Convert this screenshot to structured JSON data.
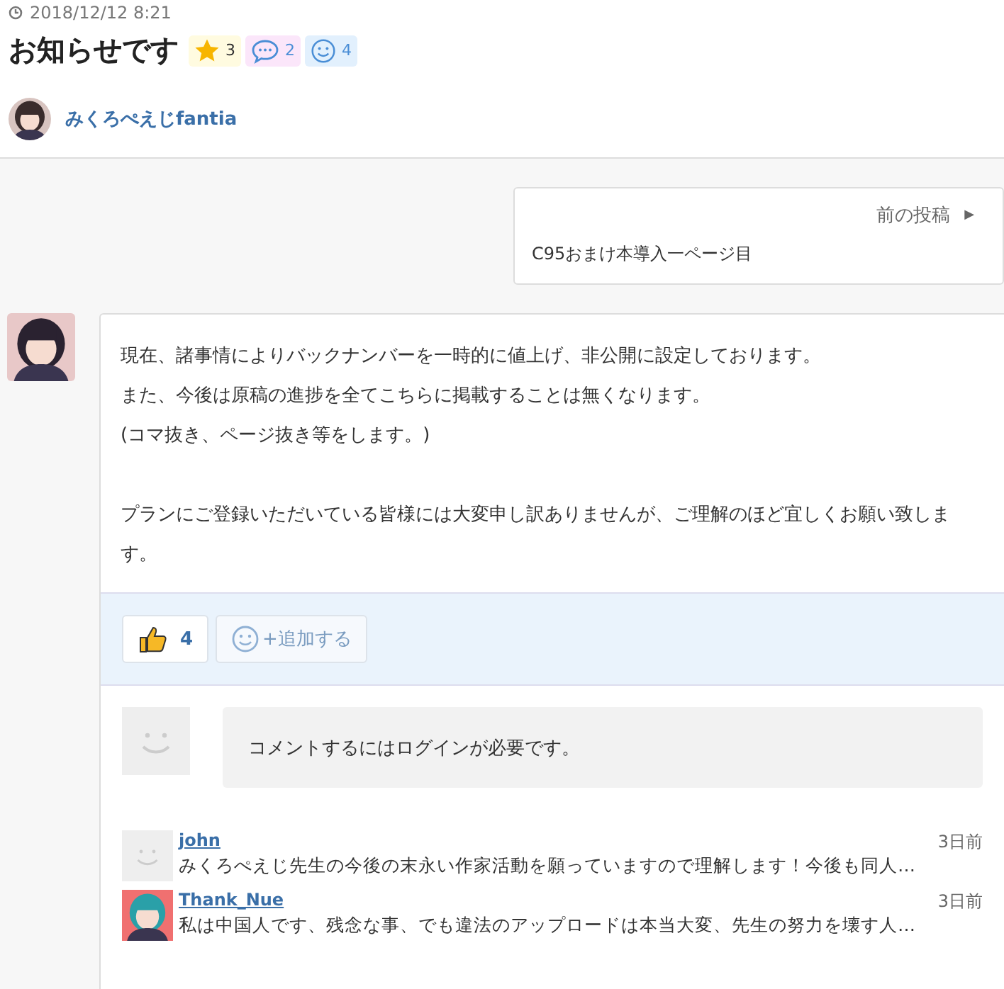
{
  "post": {
    "date": "2018/12/12 8:21",
    "title": "お知らせです",
    "badges": [
      {
        "kind": "star",
        "count": "3"
      },
      {
        "kind": "comment",
        "count": "2"
      },
      {
        "kind": "smile",
        "count": "4"
      }
    ],
    "author": "みくろぺえじfantia"
  },
  "prev_post": {
    "label": "前の投稿",
    "arrow": "▶",
    "title": "C95おまけ本導入一ページ目"
  },
  "body": [
    [
      "現在、諸事情によりバックナンバーを一時的に値上げ、非公開に設定しております。",
      "また、今後は原稿の進捗を全てこちらに掲載することは無くなります。",
      "(コマ抜き、ページ抜き等をします。)"
    ],
    [
      "プランにご登録いただいている皆様には大変申し訳ありませんが、ご理解のほど宜しくお願い致します。"
    ]
  ],
  "reactions": {
    "like_count": "4",
    "add_label": "+追加する"
  },
  "login_notice": "コメントするにはログインが必要です。",
  "comments": [
    {
      "kind": "default",
      "user": "john",
      "time": "3日前",
      "text": "みくろぺえじ先生の今後の末永い作家活動を願っていますので理解します！今後も同人…"
    },
    {
      "kind": "picture",
      "user": "Thank_Nue",
      "time": "3日前",
      "text": "私は中国人です、残念な事、でも違法のアップロードは本当大変、先生の努力を壊す人…"
    }
  ]
}
